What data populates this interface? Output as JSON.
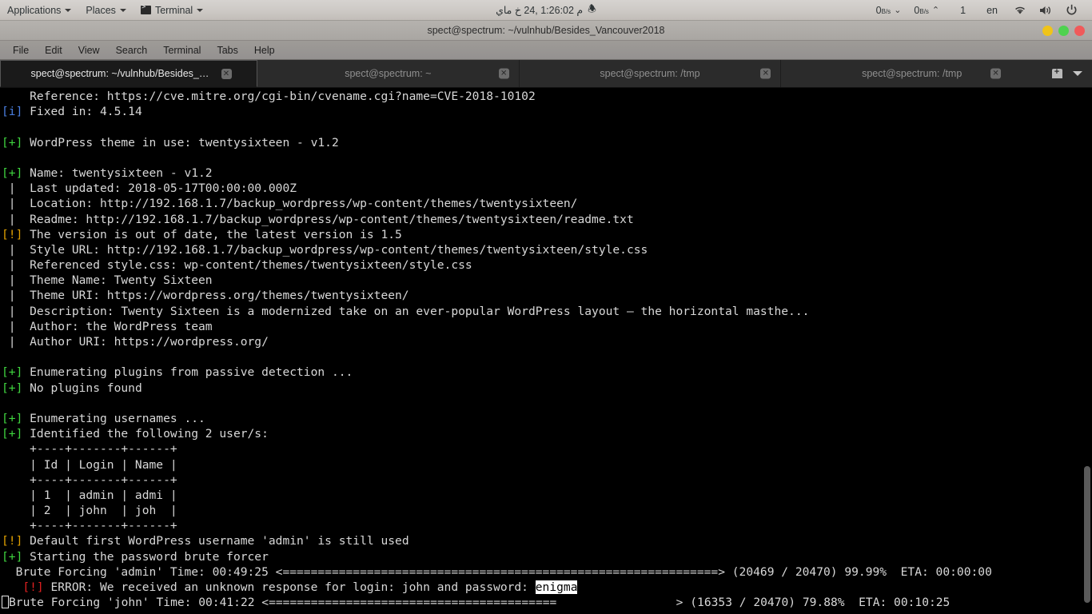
{
  "panel": {
    "menus": [
      {
        "label": "Applications",
        "icon": "none"
      },
      {
        "label": "Places",
        "icon": "none"
      },
      {
        "label": "Terminal",
        "icon": "terminal-icon"
      }
    ],
    "clock": "م 1:26:02  ,24 خ ماي",
    "clock_suffix": "🕭",
    "net_down": "0",
    "net_down_unit": "B/s",
    "net_up": "0",
    "net_up_unit": "B/s",
    "workspace": "1",
    "keyboard_layout": "en",
    "icons": [
      "wifi-icon",
      "volume-icon",
      "power-icon"
    ]
  },
  "window": {
    "title": "spect@spectrum: ~/vulnhub/Besides_Vancouver2018",
    "buttons": [
      {
        "name": "minimize",
        "color": "#f0c419"
      },
      {
        "name": "maximize",
        "color": "#4fd24f"
      },
      {
        "name": "close",
        "color": "#f05a5a"
      }
    ],
    "menubar": [
      "File",
      "Edit",
      "View",
      "Search",
      "Terminal",
      "Tabs",
      "Help"
    ],
    "tabs": [
      {
        "label": "spect@spectrum: ~/vulnhub/Besides_Va…",
        "active": true
      },
      {
        "label": "spect@spectrum: ~",
        "active": false
      },
      {
        "label": "spect@spectrum: /tmp",
        "active": false
      },
      {
        "label": "spect@spectrum: /tmp",
        "active": false
      }
    ],
    "tab_tools": [
      "new-tab-icon",
      "tab-list-dropdown-icon"
    ]
  },
  "terminal": {
    "colors": {
      "background": "#000000",
      "foreground": "#d8d8d8",
      "green": "#3fd43f",
      "blue": "#4a7fe0",
      "orange": "#e0a000",
      "red": "#e02020",
      "selection_bg": "#ffffff",
      "selection_fg": "#000000"
    },
    "lines": [
      {
        "segs": [
          {
            "t": "    Reference: https://cve.mitre.org/cgi-bin/cvename.cgi?name=CVE-2018-10102"
          }
        ]
      },
      {
        "segs": [
          {
            "t": "[i]",
            "c": "c-blue"
          },
          {
            "t": " Fixed in: 4.5.14"
          }
        ]
      },
      {
        "segs": [
          {
            "t": ""
          }
        ]
      },
      {
        "segs": [
          {
            "t": "[+]",
            "c": "c-green"
          },
          {
            "t": " WordPress theme in use: twentysixteen - v1.2"
          }
        ]
      },
      {
        "segs": [
          {
            "t": ""
          }
        ]
      },
      {
        "segs": [
          {
            "t": "[+]",
            "c": "c-green"
          },
          {
            "t": " Name: twentysixteen - v1.2"
          }
        ]
      },
      {
        "segs": [
          {
            "t": " |  Last updated: 2018-05-17T00:00:00.000Z"
          }
        ]
      },
      {
        "segs": [
          {
            "t": " |  Location: http://192.168.1.7/backup_wordpress/wp-content/themes/twentysixteen/"
          }
        ]
      },
      {
        "segs": [
          {
            "t": " |  Readme: http://192.168.1.7/backup_wordpress/wp-content/themes/twentysixteen/readme.txt"
          }
        ]
      },
      {
        "segs": [
          {
            "t": "[!]",
            "c": "c-orange"
          },
          {
            "t": " The version is out of date, the latest version is 1.5"
          }
        ]
      },
      {
        "segs": [
          {
            "t": " |  Style URL: http://192.168.1.7/backup_wordpress/wp-content/themes/twentysixteen/style.css"
          }
        ]
      },
      {
        "segs": [
          {
            "t": " |  Referenced style.css: wp-content/themes/twentysixteen/style.css"
          }
        ]
      },
      {
        "segs": [
          {
            "t": " |  Theme Name: Twenty Sixteen"
          }
        ]
      },
      {
        "segs": [
          {
            "t": " |  Theme URI: https://wordpress.org/themes/twentysixteen/"
          }
        ]
      },
      {
        "segs": [
          {
            "t": " |  Description: Twenty Sixteen is a modernized take on an ever-popular WordPress layout — the horizontal masthe..."
          }
        ]
      },
      {
        "segs": [
          {
            "t": " |  Author: the WordPress team"
          }
        ]
      },
      {
        "segs": [
          {
            "t": " |  Author URI: https://wordpress.org/"
          }
        ]
      },
      {
        "segs": [
          {
            "t": ""
          }
        ]
      },
      {
        "segs": [
          {
            "t": "[+]",
            "c": "c-green"
          },
          {
            "t": " Enumerating plugins from passive detection ..."
          }
        ]
      },
      {
        "segs": [
          {
            "t": "[+]",
            "c": "c-green"
          },
          {
            "t": " No plugins found"
          }
        ]
      },
      {
        "segs": [
          {
            "t": ""
          }
        ]
      },
      {
        "segs": [
          {
            "t": "[+]",
            "c": "c-green"
          },
          {
            "t": " Enumerating usernames ..."
          }
        ]
      },
      {
        "segs": [
          {
            "t": "[+]",
            "c": "c-green"
          },
          {
            "t": " Identified the following 2 user/s:"
          }
        ]
      },
      {
        "segs": [
          {
            "t": "    +----+-------+------+"
          }
        ]
      },
      {
        "segs": [
          {
            "t": "    | Id | Login | Name |"
          }
        ]
      },
      {
        "segs": [
          {
            "t": "    +----+-------+------+"
          }
        ]
      },
      {
        "segs": [
          {
            "t": "    | 1  | admin | admi |"
          }
        ]
      },
      {
        "segs": [
          {
            "t": "    | 2  | john  | joh  |"
          }
        ]
      },
      {
        "segs": [
          {
            "t": "    +----+-------+------+"
          }
        ]
      },
      {
        "segs": [
          {
            "t": "[!]",
            "c": "c-orange"
          },
          {
            "t": " Default first WordPress username 'admin' is still used"
          }
        ]
      },
      {
        "segs": [
          {
            "t": "[+]",
            "c": "c-green"
          },
          {
            "t": " Starting the password brute forcer"
          }
        ]
      },
      {
        "segs": [
          {
            "t": "  Brute Forcing 'admin' Time: 00:49:25 <==============================================================> (20469 / 20470) 99.99%  ETA: 00:00:00"
          }
        ]
      },
      {
        "segs": [
          {
            "t": "   "
          },
          {
            "t": "[!]",
            "c": "c-red"
          },
          {
            "t": " ERROR: We received an unknown response for login: john and password: "
          },
          {
            "t": "enigma",
            "c": "sel"
          }
        ]
      },
      {
        "segs": [
          {
            "cursor": true
          },
          {
            "t": "Brute Forcing 'john' Time: 00:41:22 <=========================================                 > (16353 / 20470) 79.88%  ETA: 00:10:25"
          }
        ]
      }
    ],
    "scrollbar": {
      "thumb_top_pct": 72,
      "thumb_height_pct": 26
    }
  }
}
